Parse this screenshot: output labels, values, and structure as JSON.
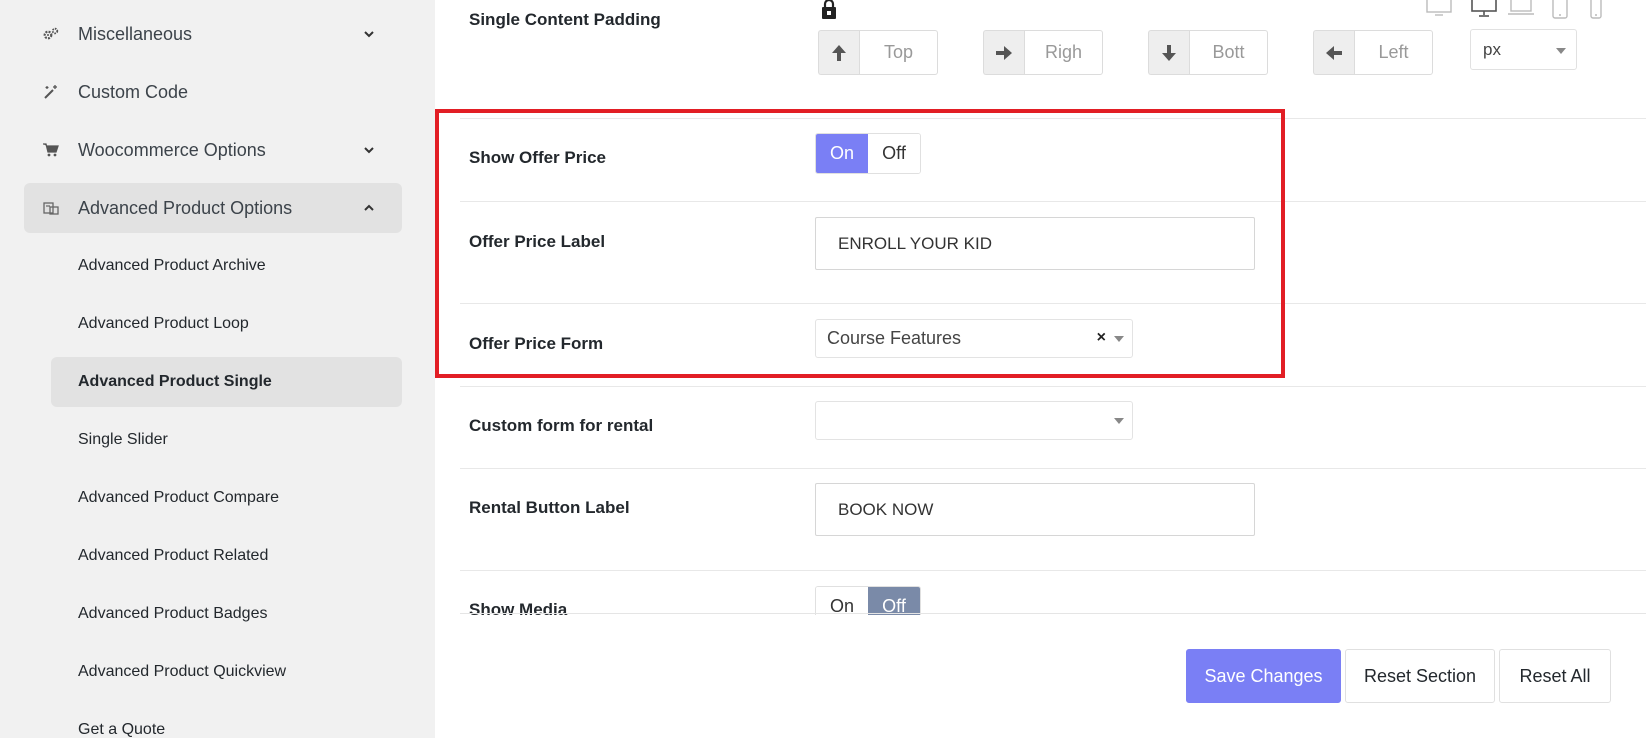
{
  "sidebar": {
    "items": [
      {
        "label": "Miscellaneous",
        "icon": "gears-icon",
        "chevron": "down"
      },
      {
        "label": "Custom Code",
        "icon": "magic-wand-icon",
        "chevron": "none"
      },
      {
        "label": "Woocommerce Options",
        "icon": "cart-icon",
        "chevron": "down"
      },
      {
        "label": "Advanced Product Options",
        "icon": "product-options-icon",
        "chevron": "up"
      }
    ],
    "sub_items": [
      "Advanced Product Archive",
      "Advanced Product Loop",
      "Advanced Product Single",
      "Single Slider",
      "Advanced Product Compare",
      "Advanced Product Related",
      "Advanced Product Badges",
      "Advanced Product Quickview",
      "Get a Quote"
    ],
    "active_sub_item": "Advanced Product Single"
  },
  "main": {
    "padding": {
      "label": "Single Content Padding",
      "top_placeholder": "Top",
      "right_placeholder": "Righ",
      "bottom_placeholder": "Bott",
      "left_placeholder": "Left",
      "unit": "px"
    },
    "show_offer_price": {
      "label": "Show Offer Price",
      "on": "On",
      "off": "Off",
      "value": "On"
    },
    "offer_price_label": {
      "label": "Offer Price Label",
      "value": "ENROLL YOUR KID"
    },
    "offer_price_form": {
      "label": "Offer Price Form",
      "value": "Course Features",
      "clear": "×"
    },
    "custom_form_rental": {
      "label": "Custom form for rental",
      "value": ""
    },
    "rental_button_label": {
      "label": "Rental Button Label",
      "value": "BOOK NOW"
    },
    "show_media": {
      "label": "Show Media",
      "on": "On",
      "off": "Off",
      "value": "Off"
    }
  },
  "footer": {
    "save": "Save Changes",
    "reset_section": "Reset Section",
    "reset_all": "Reset All"
  },
  "colors": {
    "accent": "#7a7ff5",
    "highlight": "#e21e25",
    "sidebar_bg": "#f1f1f1"
  }
}
